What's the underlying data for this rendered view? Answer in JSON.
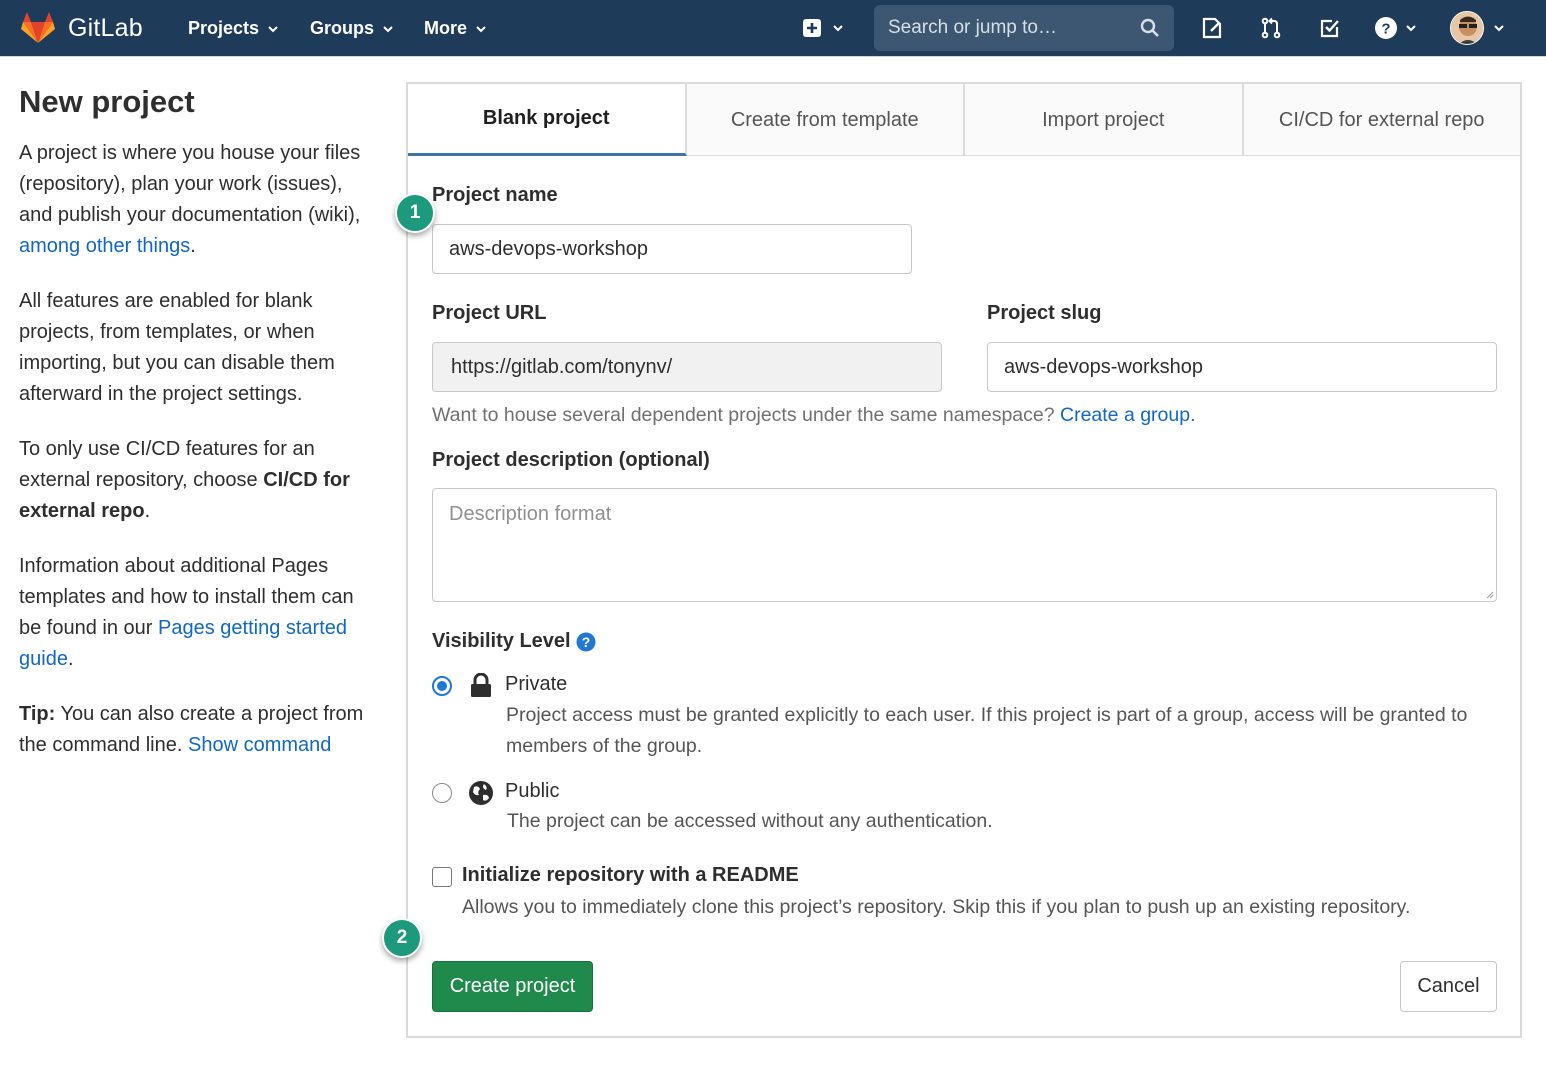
{
  "navbar": {
    "brand": "GitLab",
    "menus": [
      "Projects",
      "Groups",
      "More"
    ],
    "search_placeholder": "Search or jump to…",
    "icons": [
      "plus-square-icon",
      "issues-icon",
      "merge-request-icon",
      "todo-icon",
      "help-icon",
      "avatar"
    ]
  },
  "sidebar": {
    "title": "New project",
    "p1_text": "A project is where you house your files (repository), plan your work (issues), and publish your documentation (wiki), ",
    "p1_link": "among other things",
    "p1_end": ".",
    "p2_text": "All features are enabled for blank projects, from templates, or when importing, but you can disable them afterward in the project settings.",
    "p3_text": "To only use CI/CD features for an external repository, choose ",
    "p3_bold": "CI/CD for external repo",
    "p3_end": ".",
    "p4_text": "Information about additional Pages templates and how to install them can be found in our ",
    "p4_link": "Pages getting started guide",
    "p4_end": ".",
    "tip_label": "Tip:",
    "tip_text": " You can also create a project from the command line. ",
    "tip_link": "Show command"
  },
  "tabs": [
    "Blank project",
    "Create from template",
    "Import project",
    "CI/CD for external repo"
  ],
  "form": {
    "name_label": "Project name",
    "name_value": "aws-devops-workshop",
    "url_label": "Project URL",
    "url_value": "https://gitlab.com/tonynv/",
    "slug_label": "Project slug",
    "slug_value": "aws-devops-workshop",
    "namespace_help": "Want to house several dependent projects under the same namespace? ",
    "namespace_link": "Create a group.",
    "desc_label": "Project description (optional)",
    "desc_placeholder": "Description format",
    "visibility_label": "Visibility Level",
    "private_label": "Private",
    "private_desc": "Project access must be granted explicitly to each user. If this project is part of a group, access will be granted to members of the group.",
    "public_label": "Public",
    "public_desc": "The project can be accessed without any authentication.",
    "readme_label": "Initialize repository with a README",
    "readme_desc": "Allows you to immediately clone this project’s repository. Skip this if you plan to push up an existing repository.",
    "create_button": "Create project",
    "cancel_button": "Cancel"
  },
  "annotations": {
    "step1": "1",
    "step2": "2"
  },
  "colors": {
    "navbar": "#1f3b5a",
    "link": "#1068bf",
    "primary": "#1f8a4c",
    "step_badge": "#1d9a7b",
    "radio_checked": "#1f78d1"
  }
}
